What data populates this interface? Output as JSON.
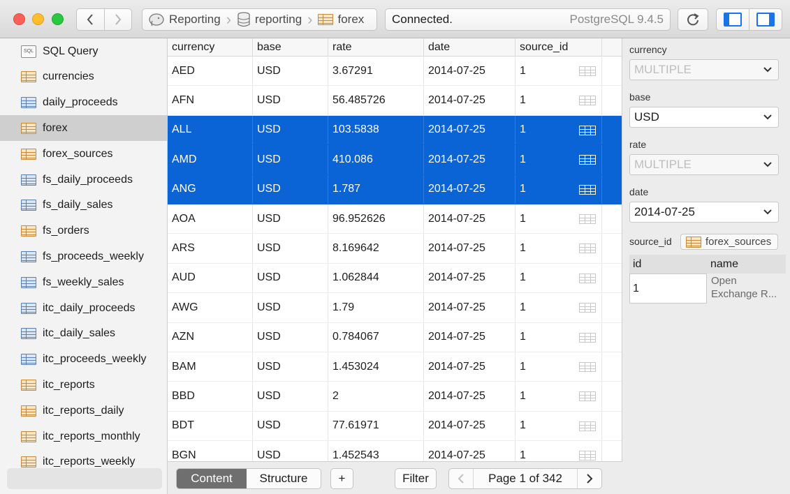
{
  "toolbar": {
    "breadcrumbs": [
      {
        "label": "Reporting",
        "icon": "elephant-icon"
      },
      {
        "label": "reporting",
        "icon": "database-icon"
      },
      {
        "label": "forex",
        "icon": "table-icon"
      }
    ],
    "status": "Connected.",
    "server_version": "PostgreSQL 9.4.5"
  },
  "sidebar": {
    "items": [
      {
        "label": "SQL Query",
        "icon": "sql-icon"
      },
      {
        "label": "currencies",
        "icon": "orange"
      },
      {
        "label": "daily_proceeds",
        "icon": "blue"
      },
      {
        "label": "forex",
        "icon": "orange"
      },
      {
        "label": "forex_sources",
        "icon": "orange"
      },
      {
        "label": "fs_daily_proceeds",
        "icon": "blue"
      },
      {
        "label": "fs_daily_sales",
        "icon": "blue"
      },
      {
        "label": "fs_orders",
        "icon": "orange"
      },
      {
        "label": "fs_proceeds_weekly",
        "icon": "blue"
      },
      {
        "label": "fs_weekly_sales",
        "icon": "blue"
      },
      {
        "label": "itc_daily_proceeds",
        "icon": "blue"
      },
      {
        "label": "itc_daily_sales",
        "icon": "blue"
      },
      {
        "label": "itc_proceeds_weekly",
        "icon": "blue"
      },
      {
        "label": "itc_reports",
        "icon": "orange"
      },
      {
        "label": "itc_reports_daily",
        "icon": "orange"
      },
      {
        "label": "itc_reports_monthly",
        "icon": "orange"
      },
      {
        "label": "itc_reports_weekly",
        "icon": "orange"
      }
    ],
    "selected": "forex"
  },
  "grid": {
    "columns": [
      "currency",
      "base",
      "rate",
      "date",
      "source_id"
    ],
    "rows": [
      {
        "currency": "AED",
        "base": "USD",
        "rate": "3.67291",
        "date": "2014-07-25",
        "source_id": "1",
        "selected": false
      },
      {
        "currency": "AFN",
        "base": "USD",
        "rate": "56.485726",
        "date": "2014-07-25",
        "source_id": "1",
        "selected": false
      },
      {
        "currency": "ALL",
        "base": "USD",
        "rate": "103.5838",
        "date": "2014-07-25",
        "source_id": "1",
        "selected": true
      },
      {
        "currency": "AMD",
        "base": "USD",
        "rate": "410.086",
        "date": "2014-07-25",
        "source_id": "1",
        "selected": true
      },
      {
        "currency": "ANG",
        "base": "USD",
        "rate": "1.787",
        "date": "2014-07-25",
        "source_id": "1",
        "selected": true
      },
      {
        "currency": "AOA",
        "base": "USD",
        "rate": "96.952626",
        "date": "2014-07-25",
        "source_id": "1",
        "selected": false
      },
      {
        "currency": "ARS",
        "base": "USD",
        "rate": "8.169642",
        "date": "2014-07-25",
        "source_id": "1",
        "selected": false
      },
      {
        "currency": "AUD",
        "base": "USD",
        "rate": "1.062844",
        "date": "2014-07-25",
        "source_id": "1",
        "selected": false
      },
      {
        "currency": "AWG",
        "base": "USD",
        "rate": "1.79",
        "date": "2014-07-25",
        "source_id": "1",
        "selected": false
      },
      {
        "currency": "AZN",
        "base": "USD",
        "rate": "0.784067",
        "date": "2014-07-25",
        "source_id": "1",
        "selected": false
      },
      {
        "currency": "BAM",
        "base": "USD",
        "rate": "1.453024",
        "date": "2014-07-25",
        "source_id": "1",
        "selected": false
      },
      {
        "currency": "BBD",
        "base": "USD",
        "rate": "2",
        "date": "2014-07-25",
        "source_id": "1",
        "selected": false
      },
      {
        "currency": "BDT",
        "base": "USD",
        "rate": "77.61971",
        "date": "2014-07-25",
        "source_id": "1",
        "selected": false
      },
      {
        "currency": "BGN",
        "base": "USD",
        "rate": "1.452543",
        "date": "2014-07-25",
        "source_id": "1",
        "selected": false
      }
    ]
  },
  "bottom": {
    "tabs": [
      "Content",
      "Structure"
    ],
    "active_tab": "Content",
    "add_label": "+",
    "filter_label": "Filter",
    "page_label": "Page 1 of 342"
  },
  "inspector": {
    "fields": [
      {
        "label": "currency",
        "value": "MULTIPLE",
        "placeholder": true
      },
      {
        "label": "base",
        "value": "USD",
        "placeholder": false
      },
      {
        "label": "rate",
        "value": "MULTIPLE",
        "placeholder": true
      },
      {
        "label": "date",
        "value": "2014-07-25",
        "placeholder": false
      }
    ],
    "source_label": "source_id",
    "source_link": "forex_sources",
    "related_columns": [
      "id",
      "name"
    ],
    "related_row": {
      "id": "1",
      "name": "Open Exchange R..."
    }
  },
  "colors": {
    "selection": "#0a64d6",
    "sidebar_selected": "#cfcfcf",
    "segment_active": "#6f6f6f"
  }
}
